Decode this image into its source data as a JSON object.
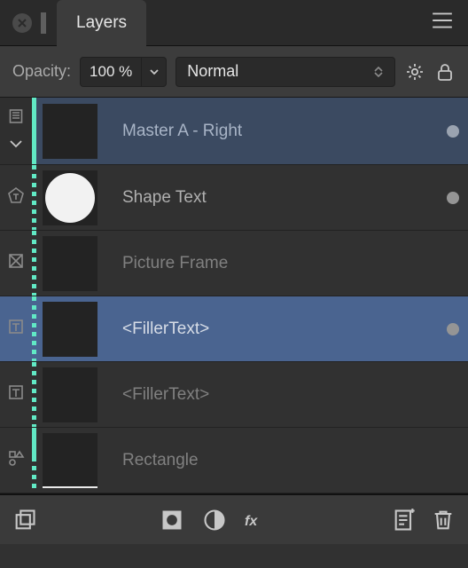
{
  "panel": {
    "title": "Layers"
  },
  "toolbar": {
    "opacity_label": "Opacity:",
    "opacity_value": "100 %",
    "blend_mode": "Normal"
  },
  "layers": [
    {
      "kind": "master",
      "icon": "page-icon",
      "name": "Master A - Right",
      "visible": true,
      "expanded": true,
      "thumb": "blank",
      "rail": "solid"
    },
    {
      "kind": "child",
      "icon": "pentagon-text-icon",
      "name": "Shape Text",
      "visible": true,
      "thumb": "circle",
      "rail": "dotted"
    },
    {
      "kind": "child",
      "icon": "picture-frame-icon",
      "name": "Picture Frame",
      "visible": false,
      "thumb": "blank",
      "rail": "dotted",
      "dim": true
    },
    {
      "kind": "child",
      "icon": "text-frame-icon",
      "name": "<FillerText>",
      "visible": true,
      "thumb": "blank",
      "selected": true,
      "rail": "dotted"
    },
    {
      "kind": "child",
      "icon": "text-frame-icon",
      "name": "<FillerText>",
      "visible": false,
      "thumb": "blank",
      "rail": "dotted",
      "dim": true
    },
    {
      "kind": "child",
      "icon": "shapes-icon",
      "name": "Rectangle",
      "visible": false,
      "thumb": "line",
      "rail": "split-top",
      "dim": true
    }
  ],
  "icons": {
    "page": "page-icon",
    "chevron_down": "chevron-down-icon",
    "gear": "gear-icon",
    "lock": "lock-icon",
    "menu": "hamburger-icon",
    "close": "close-icon",
    "mask": "mask-icon",
    "adjust": "adjust-icon",
    "fx": "fx-icon",
    "new_page": "new-page-icon",
    "trash": "trash-icon",
    "stack": "duplicate-layer-icon"
  }
}
